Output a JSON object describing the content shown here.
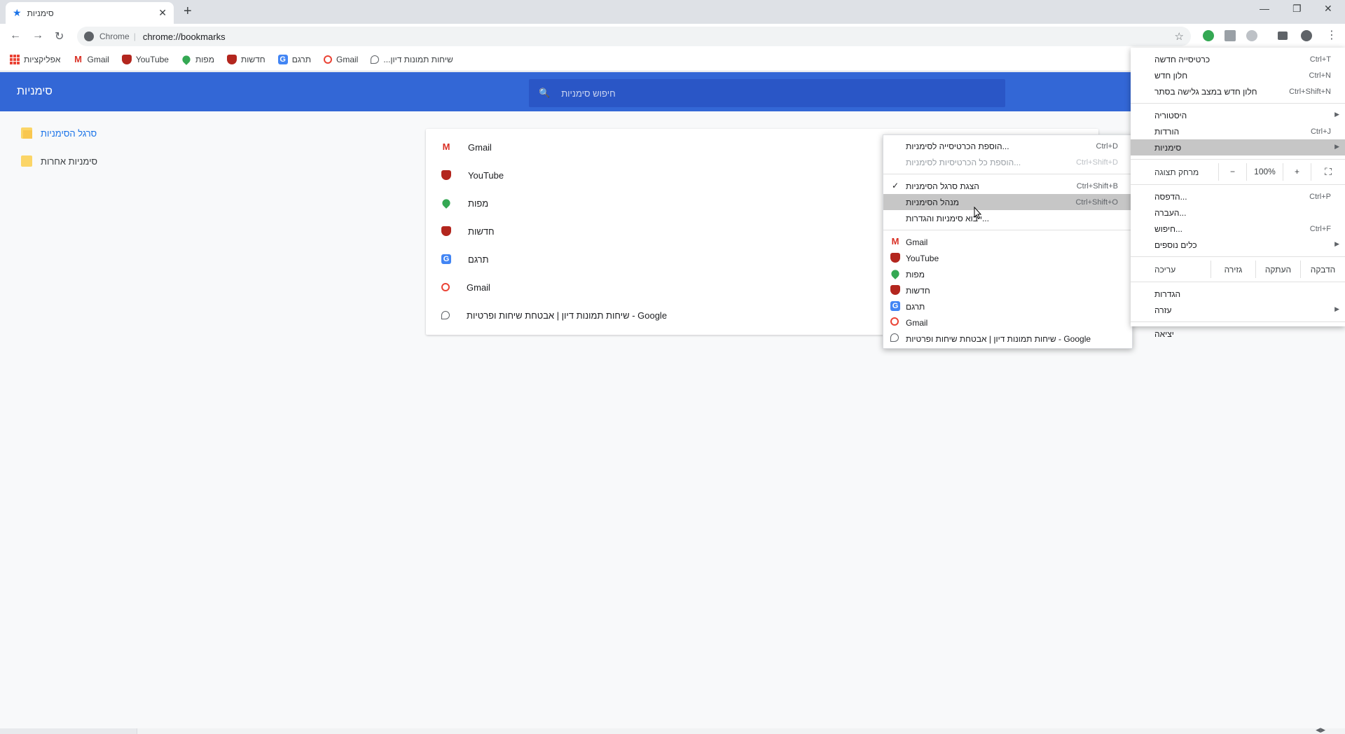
{
  "tab": {
    "title": "סימניות",
    "close": "✕",
    "newtab": "+"
  },
  "window": {
    "minimize": "—",
    "restore": "❐",
    "close": "✕"
  },
  "omnibox": {
    "chrome_label": "Chrome",
    "separator": "|",
    "url": "chrome://bookmarks"
  },
  "bookmarks_bar": [
    {
      "label": "אפליקציות",
      "icon": "apps-icon"
    },
    {
      "label": "Gmail",
      "icon": "gmail-icon"
    },
    {
      "label": "YouTube",
      "icon": "shield-icon"
    },
    {
      "label": "מפות",
      "icon": "maps-icon"
    },
    {
      "label": "חדשות",
      "icon": "shield-icon"
    },
    {
      "label": "תרגם",
      "icon": "translate-icon"
    },
    {
      "label": "Gmail",
      "icon": "google-icon"
    },
    {
      "label": "...שיחות תמונות דיון",
      "icon": "doc-icon"
    }
  ],
  "page": {
    "title": "סימניות",
    "search_placeholder": "חיפוש סימניות"
  },
  "sidebar": [
    {
      "label": "סרגל הסימניות",
      "active": true
    },
    {
      "label": "סימניות אחרות",
      "active": false
    }
  ],
  "list": [
    {
      "label": "Gmail",
      "icon": "gmail-icon"
    },
    {
      "label": "YouTube",
      "icon": "shield-icon"
    },
    {
      "label": "מפות",
      "icon": "maps-icon"
    },
    {
      "label": "חדשות",
      "icon": "shield-icon"
    },
    {
      "label": "תרגם",
      "icon": "translate-icon"
    },
    {
      "label": "Gmail",
      "icon": "google-icon"
    },
    {
      "label": "שיחות תמונות דיון | אבטחת שיחות ופרטיות - Google",
      "icon": "doc-icon"
    }
  ],
  "submenu": {
    "items": [
      {
        "label": "הוספת הכרטיסייה לסימניות...",
        "shortcut": "Ctrl+D",
        "disabled": false
      },
      {
        "label": "הוספת כל הכרטיסיות לסימניות...",
        "shortcut": "Ctrl+Shift+D",
        "disabled": true
      }
    ],
    "items2": [
      {
        "label": "הצגת סרגל הסימניות",
        "shortcut": "Ctrl+Shift+B",
        "checked": true
      },
      {
        "label": "מנהל הסימניות",
        "shortcut": "Ctrl+Shift+O",
        "highlighted": true
      },
      {
        "label": "ייבוא סימניות והגדרות...",
        "shortcut": ""
      }
    ],
    "bookmarks": [
      {
        "label": "Gmail",
        "icon": "gmail-icon"
      },
      {
        "label": "YouTube",
        "icon": "shield-icon"
      },
      {
        "label": "מפות",
        "icon": "maps-icon"
      },
      {
        "label": "חדשות",
        "icon": "shield-icon"
      },
      {
        "label": "תרגם",
        "icon": "translate-icon"
      },
      {
        "label": "Gmail",
        "icon": "google-icon"
      },
      {
        "label": "שיחות תמונות דיון | אבטחת שיחות ופרטיות - Google",
        "icon": "doc-icon"
      }
    ]
  },
  "mainmenu": {
    "group1": [
      {
        "label": "כרטיסייה חדשה",
        "shortcut": "Ctrl+T"
      },
      {
        "label": "חלון חדש",
        "shortcut": "Ctrl+N"
      },
      {
        "label": "חלון חדש במצב גלישה בסתר",
        "shortcut": "Ctrl+Shift+N"
      }
    ],
    "group2": [
      {
        "label": "היסטוריה",
        "shortcut": "",
        "arrow": true
      },
      {
        "label": "הורדות",
        "shortcut": "Ctrl+J",
        "arrow": false
      },
      {
        "label": "סימניות",
        "shortcut": "",
        "arrow": true,
        "highlighted": true
      }
    ],
    "zoom": {
      "label": "מרחק תצוגה",
      "minus": "−",
      "value": "100%",
      "plus": "+",
      "fullscreen": "⛶"
    },
    "group3": [
      {
        "label": "הדפסה...",
        "shortcut": "Ctrl+P",
        "arrow": false
      },
      {
        "label": "העברה...",
        "shortcut": "",
        "arrow": false
      },
      {
        "label": "חיפוש...",
        "shortcut": "Ctrl+F",
        "arrow": false
      },
      {
        "label": "כלים נוספים",
        "shortcut": "",
        "arrow": true
      }
    ],
    "edit": {
      "label": "עריכה",
      "cut": "גזירה",
      "copy": "העתקה",
      "paste": "הדבקה"
    },
    "group4": [
      {
        "label": "הגדרות",
        "arrow": false
      },
      {
        "label": "עזרה",
        "arrow": true
      }
    ],
    "exit": "יציאה"
  }
}
